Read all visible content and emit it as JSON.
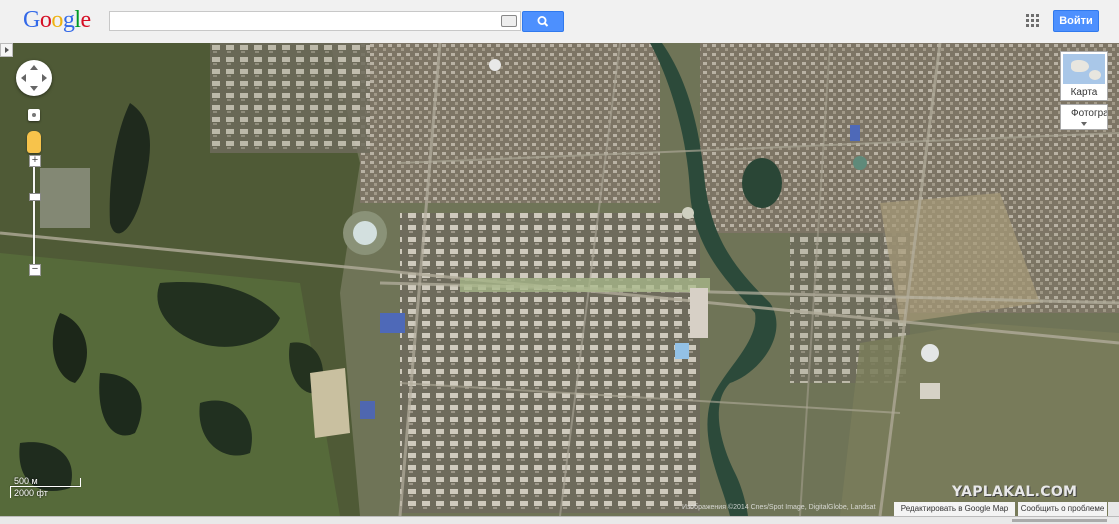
{
  "header": {
    "logo_letters": [
      {
        "ch": "G",
        "color": "#3369e8"
      },
      {
        "ch": "o",
        "color": "#d50f25"
      },
      {
        "ch": "o",
        "color": "#eeb211"
      },
      {
        "ch": "g",
        "color": "#3369e8"
      },
      {
        "ch": "l",
        "color": "#009925"
      },
      {
        "ch": "e",
        "color": "#d50f25"
      }
    ],
    "search_value": "",
    "search_placeholder": "",
    "signin_label": "Войти"
  },
  "map_controls": {
    "layer_map_label": "Карта",
    "layer_photo_label": "Фотография",
    "scale_metric": "500 м",
    "scale_imperial": "2000 фт"
  },
  "footer": {
    "attribution": "Изображения ©2014 Cnes/Spot Image, DigitalGlobe, Landsat",
    "edit_link": "Редактировать в Google Map Maker",
    "report_link": "Сообщить о проблеме",
    "watermark": "YAPLAKAL.COM"
  },
  "colors": {
    "accent": "#4d90fe",
    "terrain": "#6f7457",
    "river": "#2c4a3a"
  }
}
